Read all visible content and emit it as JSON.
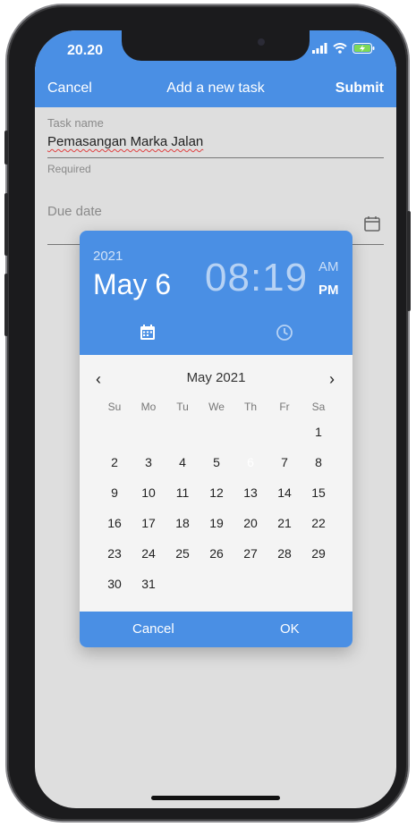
{
  "status_bar": {
    "time": "20.20"
  },
  "app_bar": {
    "cancel": "Cancel",
    "title": "Add a new task",
    "submit": "Submit"
  },
  "form": {
    "task_name_label": "Task name",
    "task_name_value": "Pemasangan Marka Jalan",
    "task_name_helper": "Required",
    "due_date_label": "Due date"
  },
  "picker": {
    "year": "2021",
    "selected_date": "May 6",
    "time": "08:19",
    "am": "AM",
    "pm": "PM",
    "month_label": "May 2021",
    "weekdays": [
      "Su",
      "Mo",
      "Tu",
      "We",
      "Th",
      "Fr",
      "Sa"
    ],
    "first_weekday_index": 6,
    "days_in_month": 31,
    "selected_day": 6,
    "cancel": "Cancel",
    "ok": "OK"
  },
  "colors": {
    "accent": "#4a8fe4",
    "screen_bg": "#dedede"
  }
}
